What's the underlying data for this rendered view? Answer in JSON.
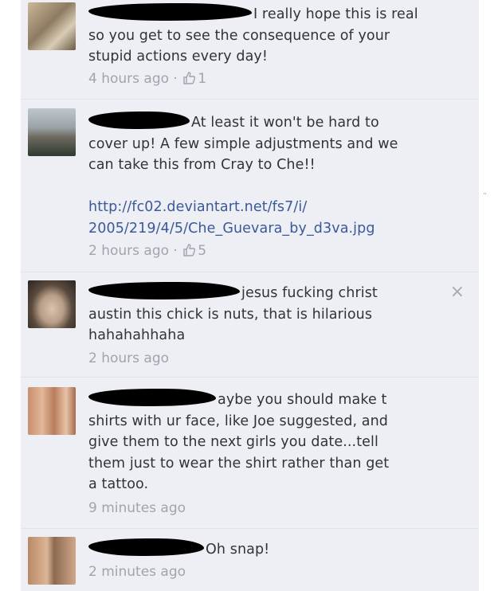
{
  "comments": [
    {
      "text_lines": [
        "I really hope this is real",
        "so you get to see the consequence of your",
        "stupid actions every day!"
      ],
      "time": "4 hours ago",
      "separator": " · ",
      "likes": "1"
    },
    {
      "text_lines": [
        "At least it won't be hard to",
        "cover up! A few simple adjustments and we",
        "can take this from Cray to Che!!"
      ],
      "link_lines": [
        "http://fc02.deviantart.net/fs7/i/",
        "2005/219/4/5/Che_Guevara_by_d3va.jpg"
      ],
      "time": "2 hours ago",
      "separator": " · ",
      "likes": "5"
    },
    {
      "text_lines": [
        "jesus fucking christ",
        "austin this chick is nuts, that is hilarious",
        "hahahahhaha"
      ],
      "time": "2 hours ago"
    },
    {
      "text_lines": [
        "aybe you should make t",
        "shirts with ur face, like Joe suggested, and",
        "give them to the next girls you date...tell",
        "them just to wear the shirt rather than get",
        "a tattoo."
      ],
      "time": "9 minutes ago"
    },
    {
      "text_lines": [
        "Oh snap!"
      ],
      "time": "2 minutes ago"
    }
  ],
  "close_symbol": "×",
  "colors": {
    "link": "#3b5998",
    "meta": "#a0a4ad",
    "text": "#333333",
    "background": "#edeff4"
  }
}
